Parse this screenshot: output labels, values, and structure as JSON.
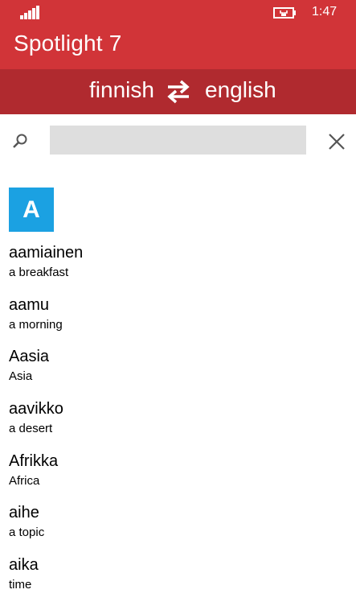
{
  "status": {
    "time": "1:47"
  },
  "header": {
    "title": "Spotlight 7"
  },
  "languages": {
    "source": "finnish",
    "target": "english"
  },
  "search": {
    "value": "",
    "placeholder": ""
  },
  "index_letter": "A",
  "words": [
    {
      "fi": "aamiainen",
      "en": "a breakfast"
    },
    {
      "fi": "aamu",
      "en": "a morning"
    },
    {
      "fi": "Aasia",
      "en": "Asia"
    },
    {
      "fi": "aavikko",
      "en": "a desert"
    },
    {
      "fi": "Afrikka",
      "en": "Africa"
    },
    {
      "fi": "aihe",
      "en": "a topic"
    },
    {
      "fi": "aika",
      "en": "time"
    }
  ],
  "colors": {
    "accent": "#d13438",
    "accent_dark": "#b02a2f",
    "tile": "#1ba1e2"
  },
  "icons": [
    "signal-icon",
    "battery-charging-icon",
    "swap-icon",
    "search-icon",
    "clear-icon"
  ]
}
